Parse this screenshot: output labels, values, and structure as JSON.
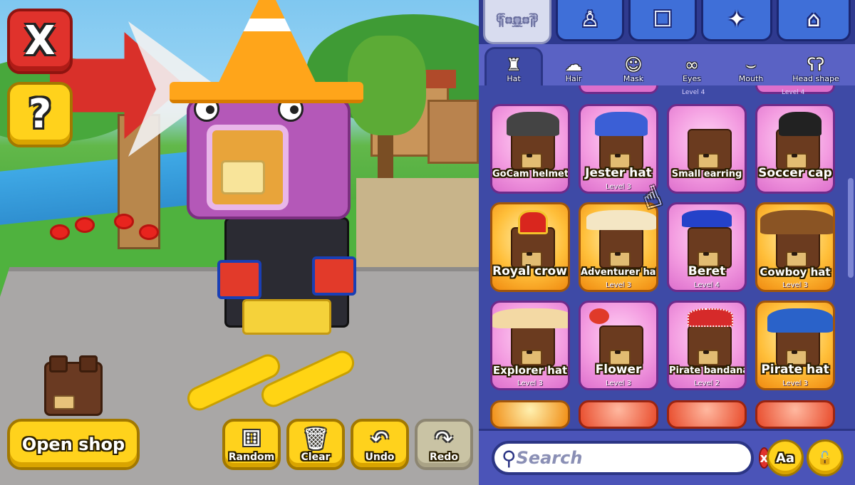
{
  "left": {
    "close_glyph": "X",
    "help_glyph": "?",
    "open_shop_label": "Open shop",
    "tools": [
      {
        "label": "Random",
        "icon": "⚅"
      },
      {
        "label": "Clear",
        "icon": "🗑"
      },
      {
        "label": "Undo",
        "icon": "↶"
      },
      {
        "label": "Redo",
        "icon": "↷"
      }
    ]
  },
  "categories": [
    {
      "name": "bear-face",
      "icon": "ʕ•ᴥ•ʔ"
    },
    {
      "name": "body",
      "icon": "♙"
    },
    {
      "name": "robot-face",
      "icon": "☐"
    },
    {
      "name": "sparkles",
      "icon": "✦"
    },
    {
      "name": "hanger",
      "icon": "⌂"
    }
  ],
  "subtabs": [
    {
      "label": "Hat",
      "icon": "♜"
    },
    {
      "label": "Hair",
      "icon": "☁"
    },
    {
      "label": "Mask",
      "icon": "☺"
    },
    {
      "label": "Eyes",
      "icon": "∞"
    },
    {
      "label": "Mouth",
      "icon": "⌣"
    },
    {
      "label": "Head shape",
      "icon": "ʕʔ"
    }
  ],
  "top_partial": {
    "left_level": "Level 4",
    "right_level": "Level 4"
  },
  "items": [
    {
      "name": "GoCam helmet",
      "level": "",
      "style": "pink",
      "deco": "#444"
    },
    {
      "name": "Jester hat",
      "level": "Level 3",
      "style": "pink",
      "deco": "#3b5fd6"
    },
    {
      "name": "Small earring",
      "level": "",
      "style": "pink",
      "deco": ""
    },
    {
      "name": "Soccer cap",
      "level": "",
      "style": "pink",
      "deco": "#222"
    },
    {
      "name": "Royal crown",
      "level": "",
      "style": "gold",
      "deco": "#d9261e"
    },
    {
      "name": "Adventurer hat",
      "level": "Level 3",
      "style": "gold",
      "deco": "#f4e6c4"
    },
    {
      "name": "Beret",
      "level": "Level 4",
      "style": "pink",
      "deco": "#2442c9"
    },
    {
      "name": "Cowboy hat",
      "level": "Level 3",
      "style": "gold",
      "deco": "#8a5424"
    },
    {
      "name": "Explorer hat",
      "level": "Level 3",
      "style": "pink",
      "deco": "#f3d9a4"
    },
    {
      "name": "Flower",
      "level": "Level 3",
      "style": "pink",
      "deco": "#e03a2a"
    },
    {
      "name": "Pirate bandana",
      "level": "Level 2",
      "style": "pink",
      "deco": "#d62a2a"
    },
    {
      "name": "Pirate hat",
      "level": "Level 3",
      "style": "gold",
      "deco": "#2a62c9"
    }
  ],
  "search": {
    "placeholder": "Search",
    "clear_glyph": "x"
  },
  "font_button_label": "Aa",
  "lock_glyph": "🔓"
}
